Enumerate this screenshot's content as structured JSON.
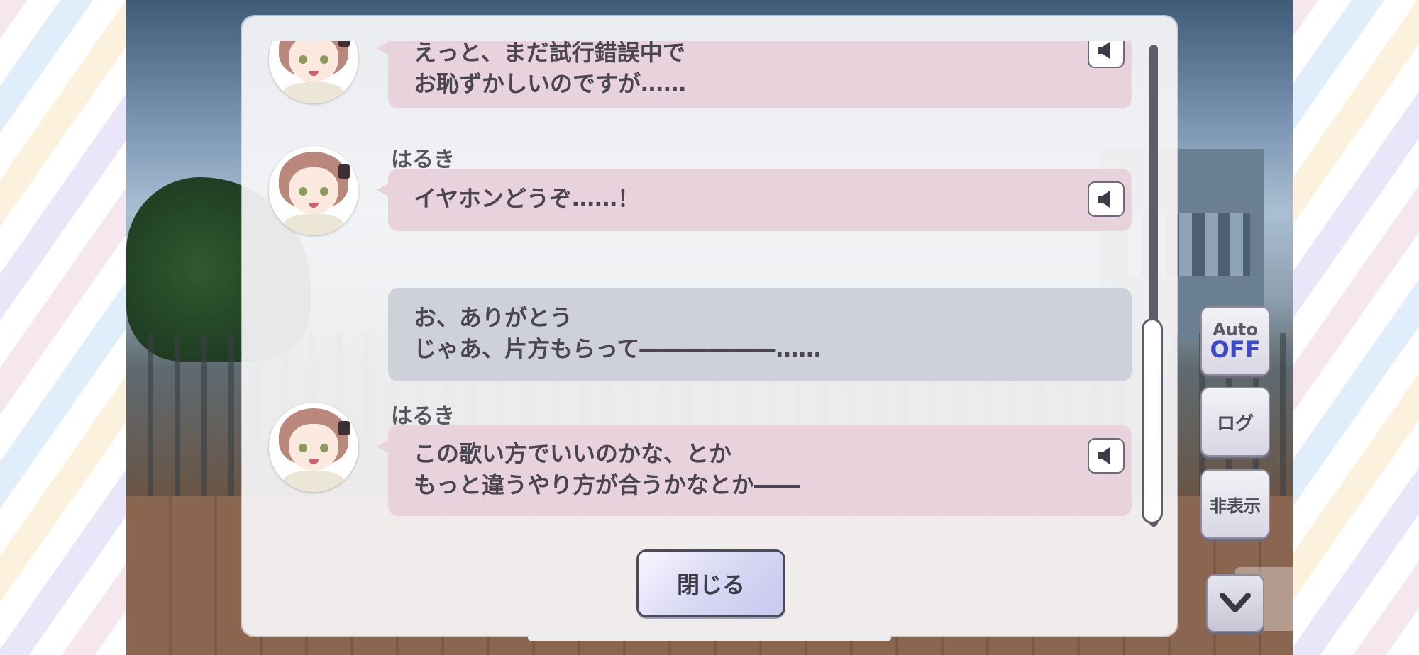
{
  "dialog_log": {
    "entries": [
      {
        "speaker": "",
        "line1": "えっと、まだ試行錯誤中で",
        "line2": "お恥ずかしいのですが……",
        "has_voice": true
      },
      {
        "speaker": "はるき",
        "line1": "イヤホンどうぞ……！",
        "line2": "",
        "has_voice": true
      },
      {
        "speaker": "",
        "line1": "お、ありがとう",
        "line2": "じゃあ、片方もらって――――――……",
        "has_voice": false
      },
      {
        "speaker": "はるき",
        "line1": "この歌い方でいいのかな、とか",
        "line2": "もっと違うやり方が合うかなとか――",
        "has_voice": true
      }
    ],
    "close_label": "閉じる"
  },
  "side_buttons": {
    "auto_label": "Auto",
    "auto_state": "OFF",
    "log_label": "ログ",
    "hide_label": "非表示"
  },
  "colors": {
    "speaker_bubble": "#e8d3dd",
    "player_bubble": "#cfd1da",
    "auto_off": "#3f49c4"
  },
  "icons": {
    "voice": "speaker-icon",
    "down": "chevron-down-icon"
  }
}
